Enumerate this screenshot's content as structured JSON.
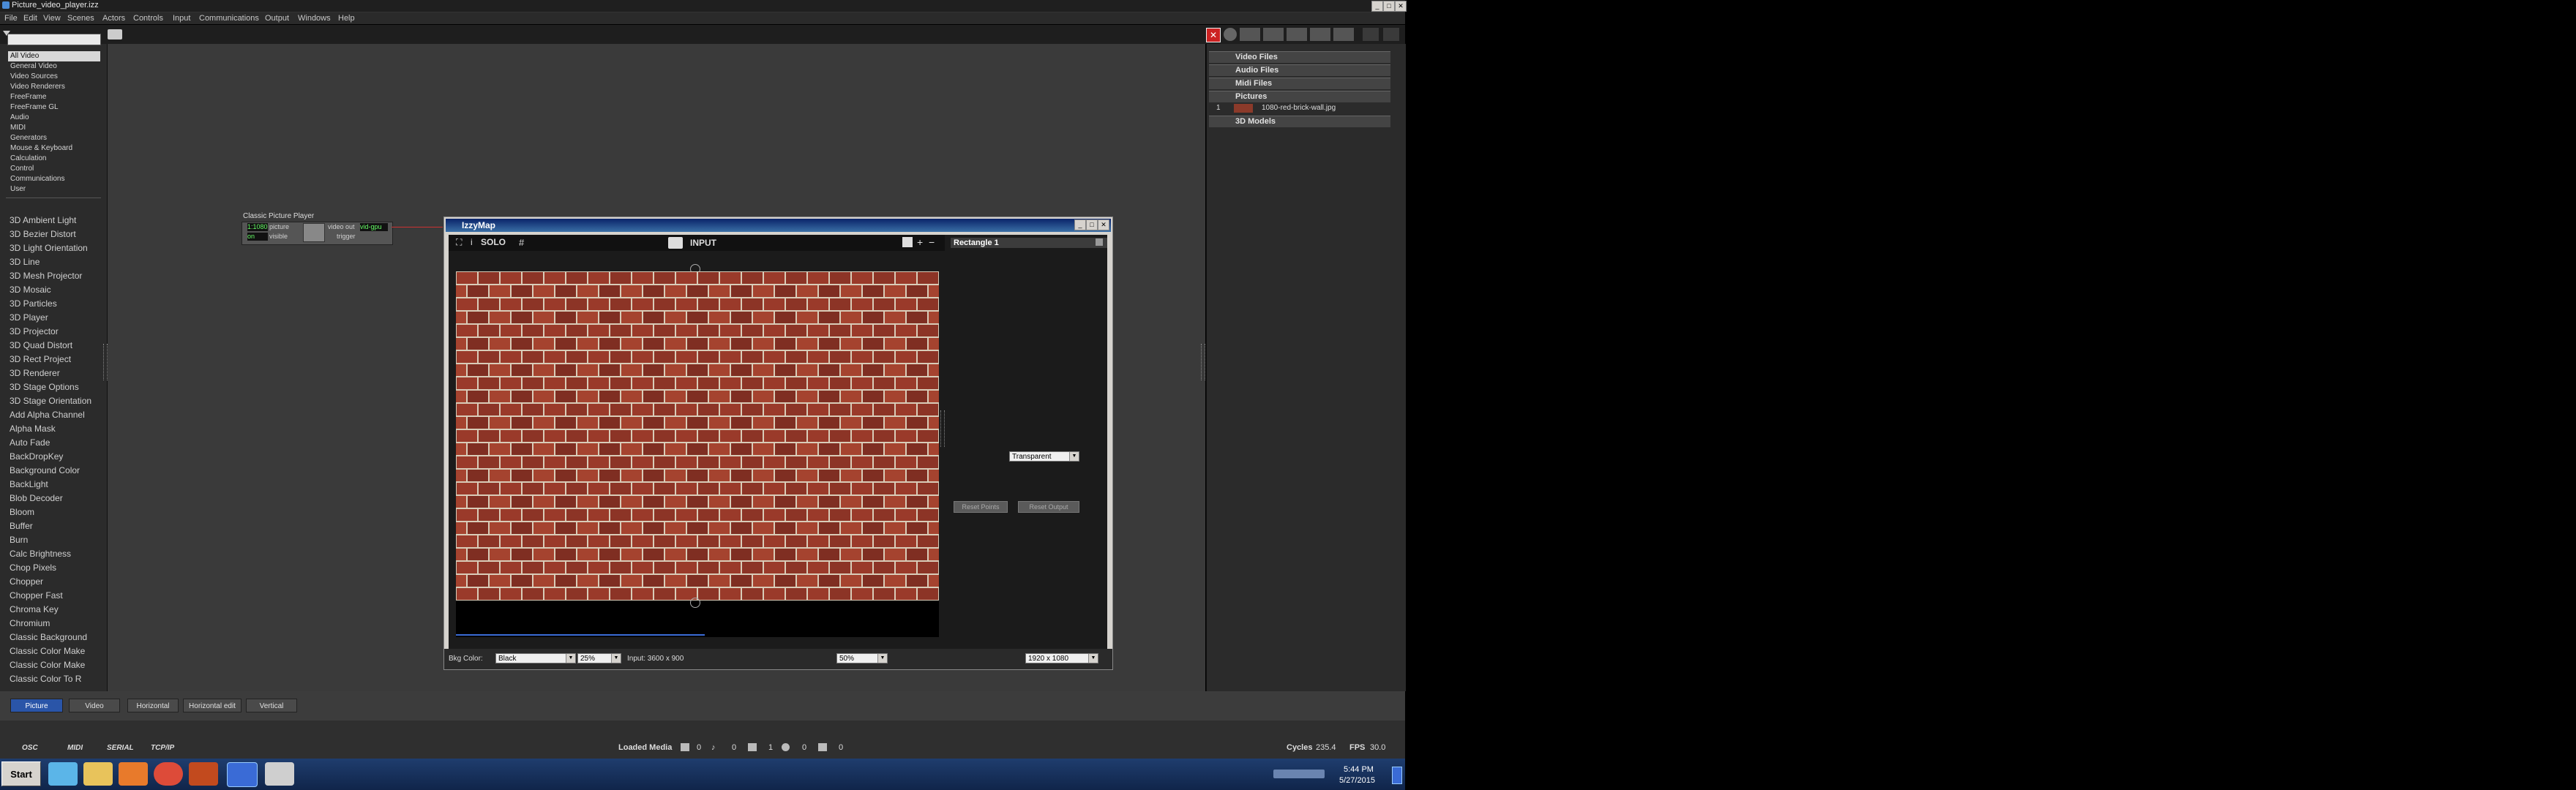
{
  "window": {
    "title": "Picture_video_player.izz"
  },
  "menu": [
    "File",
    "Edit",
    "View",
    "Scenes",
    "Actors",
    "Controls",
    "Input",
    "Communications",
    "Output",
    "Windows",
    "Help"
  ],
  "categories": [
    "All Video",
    "General Video",
    "Video Sources",
    "Video Renderers",
    "FreeFrame",
    "FreeFrame GL",
    "Audio",
    "MIDI",
    "Generators",
    "Mouse & Keyboard",
    "Calculation",
    "Control",
    "Communications",
    "User"
  ],
  "actors": [
    "3D Ambient Light",
    "3D Bezier Distort",
    "3D Light Orientation",
    "3D Line",
    "3D Mesh Projector",
    "3D Mosaic",
    "3D Particles",
    "3D Player",
    "3D Projector",
    "3D Quad Distort",
    "3D Rect Project",
    "3D Renderer",
    "3D Stage Options",
    "3D Stage Orientation",
    "Add Alpha Channel",
    "Alpha Mask",
    "Auto Fade",
    "BackDropKey",
    "Background Color",
    "BackLight",
    "Blob Decoder",
    "Bloom",
    "Buffer",
    "Burn",
    "Calc Brightness",
    "Chop Pixels",
    "Chopper",
    "Chopper Fast",
    "Chroma Key",
    "Chromium",
    "Classic Background",
    "Classic Color Make",
    "Classic Color Make",
    "Classic Color To R"
  ],
  "node": {
    "title": "Classic Picture Player",
    "in_picture_val": "1:1080",
    "in_picture": "picture",
    "in_visible_val": "on",
    "in_visible": "visible",
    "out_video": "video out",
    "out_video_val": "vid-gpu",
    "out_trigger": "trigger"
  },
  "media": {
    "sections": [
      "Video Files",
      "Audio Files",
      "Midi Files",
      "Pictures",
      "3D Models"
    ],
    "picture_index": "1",
    "picture_file": "1080-red-brick-wall.jpg"
  },
  "izzymap": {
    "title": "IzzyMap",
    "solo": "SOLO",
    "hash": "#",
    "input_label": "INPUT",
    "shape": "Rectangle 1",
    "blend": "Transparent",
    "reset_points": "Reset Points",
    "reset_output": "Reset Output",
    "bkg_label": "Bkg Color:",
    "bkg_value": "Black",
    "opacity_value": "25%",
    "input_info": "Input: 3600 x 900",
    "zoom": "50%",
    "resolution": "1920 x 1080"
  },
  "tabs": [
    "Picture",
    "Video",
    "Horizontal",
    "Horizontal edit",
    "Vertical"
  ],
  "status": {
    "protocols": [
      "OSC",
      "MIDI",
      "SERIAL",
      "TCP/IP"
    ],
    "loaded_media": "Loaded Media",
    "counts": [
      "0",
      "0",
      "1",
      "0",
      "0"
    ],
    "cycles_label": "Cycles",
    "cycles": "235.4",
    "fps_label": "FPS",
    "fps": "30.0"
  },
  "taskbar": {
    "start": "Start",
    "time": "5:44 PM",
    "date": "5/27/2015"
  }
}
